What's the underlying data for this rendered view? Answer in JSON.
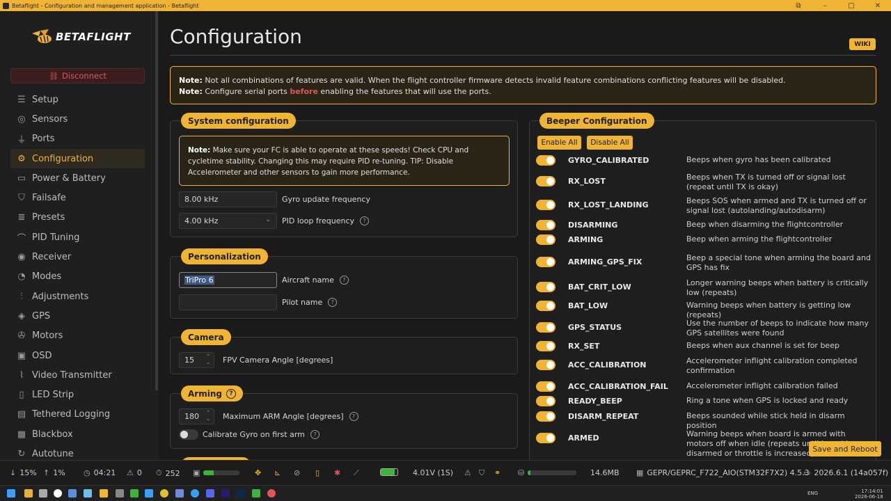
{
  "window": {
    "title": "Betaflight - Configuration and management application - Betaflight",
    "controls": [
      "⧉",
      "–",
      "▢",
      "✕"
    ]
  },
  "sidebar": {
    "logo_text": "BETAFLIGHT",
    "disconnect_label": "Disconnect",
    "items": [
      {
        "label": "Setup",
        "icon": "sliders-icon",
        "glyph": "☰",
        "active": false
      },
      {
        "label": "Sensors",
        "icon": "sensor-icon",
        "glyph": "◎",
        "active": false
      },
      {
        "label": "Ports",
        "icon": "plug-icon",
        "glyph": "⏚",
        "active": false
      },
      {
        "label": "Configuration",
        "icon": "gear-icon",
        "glyph": "⚙",
        "active": true
      },
      {
        "label": "Power & Battery",
        "icon": "battery-icon",
        "glyph": "▭",
        "active": false
      },
      {
        "label": "Failsafe",
        "icon": "failsafe-icon",
        "glyph": "⛉",
        "active": false
      },
      {
        "label": "Presets",
        "icon": "presets-icon",
        "glyph": "≣",
        "active": false
      },
      {
        "label": "PID Tuning",
        "icon": "tuning-icon",
        "glyph": "⌒",
        "active": false
      },
      {
        "label": "Receiver",
        "icon": "receiver-icon",
        "glyph": "◉",
        "active": false
      },
      {
        "label": "Modes",
        "icon": "modes-icon",
        "glyph": "◔",
        "active": false
      },
      {
        "label": "Adjustments",
        "icon": "adjustments-icon",
        "glyph": "⫶",
        "active": false
      },
      {
        "label": "GPS",
        "icon": "gps-icon",
        "glyph": "◈",
        "active": false
      },
      {
        "label": "Motors",
        "icon": "motor-icon",
        "glyph": "✇",
        "active": false
      },
      {
        "label": "OSD",
        "icon": "osd-icon",
        "glyph": "▣",
        "active": false
      },
      {
        "label": "Video Transmitter",
        "icon": "antenna-icon",
        "glyph": "⌇",
        "active": false
      },
      {
        "label": "LED Strip",
        "icon": "led-icon",
        "glyph": "▯",
        "active": false
      },
      {
        "label": "Tethered Logging",
        "icon": "logging-icon",
        "glyph": "▤",
        "active": false
      },
      {
        "label": "Blackbox",
        "icon": "blackbox-icon",
        "glyph": "▦",
        "active": false
      },
      {
        "label": "Autotune",
        "icon": "autotune-icon",
        "glyph": "↻",
        "active": false
      }
    ]
  },
  "main": {
    "title": "Configuration",
    "wiki_label": "WIKI",
    "note": {
      "line1_bold": "Note:",
      "line1": " Not all combinations of features are valid. When the flight controller firmware detects invalid feature combinations conflicting features will be disabled.",
      "line2_bold": "Note:",
      "line2_pre": " Configure serial ports ",
      "line2_red": "before",
      "line2_post": " enabling the features that will use the ports."
    },
    "system": {
      "heading": "System configuration",
      "note_bold": "Note:",
      "note_text": " Make sure your FC is able to operate at these speeds! Check CPU and cycletime stability. Changing this may require PID re-tuning. TIP: Disable Accelerometer and other sensors to gain more performance.",
      "gyro_value": "8.00 kHz",
      "gyro_label": "Gyro update frequency",
      "pid_value": "4.00 kHz",
      "pid_label": "PID loop frequency"
    },
    "personalization": {
      "heading": "Personalization",
      "aircraft_value": "TriPro 6",
      "aircraft_label": "Aircraft name",
      "pilot_value": "",
      "pilot_label": "Pilot name"
    },
    "camera": {
      "heading": "Camera",
      "angle_value": "15",
      "angle_label": "FPV Camera Angle [degrees]"
    },
    "arming": {
      "heading": "Arming",
      "max_angle_value": "180",
      "max_angle_label": "Maximum ARM Angle [degrees]",
      "calibrate_label": "Calibrate Gyro on first arm",
      "calibrate_on": false
    },
    "beeper": {
      "heading": "Beeper Configuration",
      "enable_all": "Enable All",
      "disable_all": "Disable All",
      "items": [
        {
          "name": "GYRO_CALIBRATED",
          "desc": "Beeps when gyro has been calibrated",
          "on": true
        },
        {
          "name": "RX_LOST",
          "desc": "Beeps when TX is turned off or signal lost (repeat until TX is okay)",
          "on": true
        },
        {
          "name": "RX_LOST_LANDING",
          "desc": "Beeps SOS when armed and TX is turned off or signal lost (autolanding/autodisarm)",
          "on": true
        },
        {
          "name": "DISARMING",
          "desc": "Beep when disarming the flightcontroller",
          "on": true
        },
        {
          "name": "ARMING",
          "desc": "Beep when arming the flightcontroller",
          "on": true
        },
        {
          "name": "ARMING_GPS_FIX",
          "desc": "Beep a special tone when arming the board and GPS has fix",
          "on": true
        },
        {
          "name": "BAT_CRIT_LOW",
          "desc": "Longer warning beeps when battery is critically low (repeats)",
          "on": true
        },
        {
          "name": "BAT_LOW",
          "desc": "Warning beeps when battery is getting low (repeats)",
          "on": true
        },
        {
          "name": "GPS_STATUS",
          "desc": "Use the number of beeps to indicate how many GPS satellites were found",
          "on": true
        },
        {
          "name": "RX_SET",
          "desc": "Beeps when aux channel is set for beep",
          "on": true
        },
        {
          "name": "ACC_CALIBRATION",
          "desc": "Accelerometer inflight calibration completed confirmation",
          "on": true
        },
        {
          "name": "ACC_CALIBRATION_FAIL",
          "desc": "Accelerometer inflight calibration failed",
          "on": true
        },
        {
          "name": "READY_BEEP",
          "desc": "Ring a tone when GPS is locked and ready",
          "on": true
        },
        {
          "name": "DISARM_REPEAT",
          "desc": "Beeps sounded while stick held in disarm position",
          "on": true
        },
        {
          "name": "ARMED",
          "desc": "Warning beeps when board is armed with motors off when idle (repeats until board is disarmed or throttle is increased)",
          "on": true
        }
      ]
    },
    "save_reboot_label": "Save and Reboot"
  },
  "statusbar": {
    "port_down": "15%",
    "port_up": "1%",
    "timer": "04:21",
    "warnings": "0",
    "cycle": "252",
    "cpu_fraction": 0.28,
    "voltage": "4.01V (1S)",
    "battery_fraction": 0.85,
    "memory_fraction": 0.05,
    "memory": "14.6MB",
    "firmware": "GEPR/GEPRC_F722_AIO(STM32F7X2) 4.5.3",
    "version": "2026.6.1 (14a057f)",
    "colors": {
      "accent": "#f0b434",
      "ok": "#3db33d",
      "danger": "#e05555"
    }
  },
  "taskbar": {
    "lang": "ENG",
    "time": "17:14:01",
    "date": "2026-06-18"
  }
}
